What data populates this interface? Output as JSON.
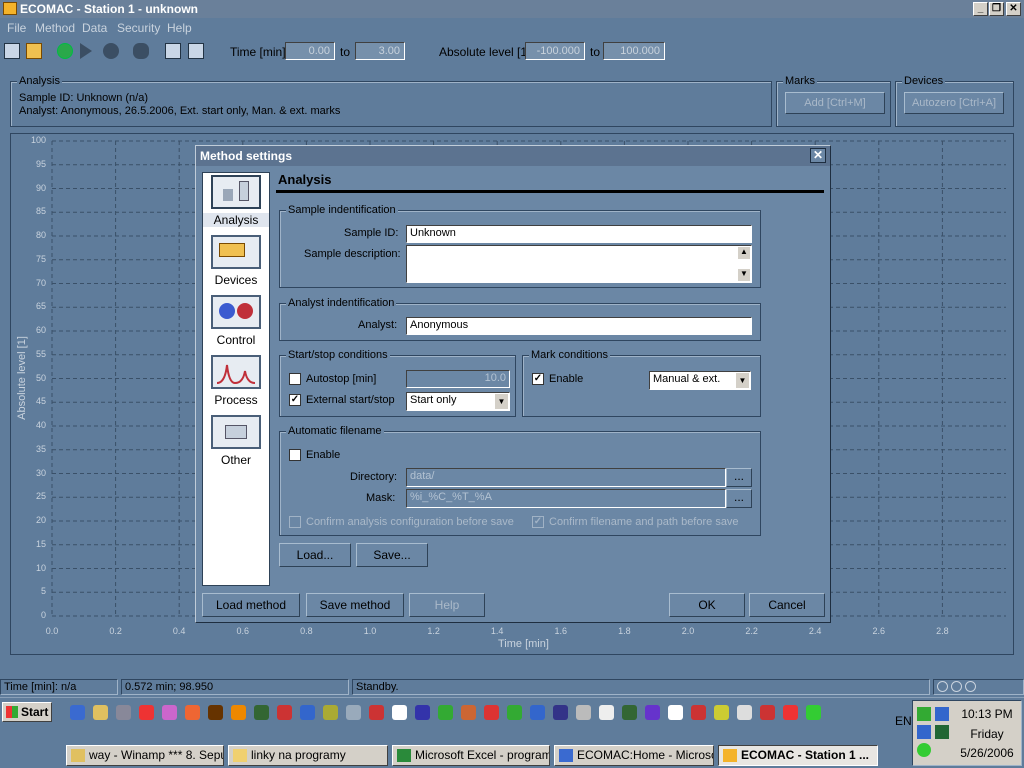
{
  "window": {
    "title": "ECOMAC - Station 1 - unknown",
    "min_icon": "minimize-icon",
    "max_icon": "restore-icon",
    "close_icon": "close-icon"
  },
  "menu": [
    "File",
    "Method",
    "Data",
    "Security",
    "Help"
  ],
  "toolbar": {
    "time_label": "Time [min]:",
    "time_from": "0.00",
    "to1": "to",
    "time_to": "3.00",
    "level_label": "Absolute level [1]",
    "level_from": "-100.000",
    "to2": "to",
    "level_to": "100.000"
  },
  "analysis_panel": {
    "title": "Analysis",
    "line1": "Sample ID: Unknown (n/a)",
    "line2": "Analyst: Anonymous, 26.5.2006, Ext. start only, Man. & ext. marks"
  },
  "marks_panel": {
    "title": "Marks",
    "button": "Add [Ctrl+M]"
  },
  "devices_panel": {
    "title": "Devices",
    "button": "Autozero [Ctrl+A]"
  },
  "chart_data": {
    "type": "line",
    "title": "",
    "xlabel": "Time [min]",
    "ylabel": "Absolute level [1]",
    "xlim": [
      0.0,
      3.0
    ],
    "ylim": [
      0,
      100
    ],
    "x_ticks": [
      "0.0",
      "0.2",
      "0.4",
      "0.6",
      "0.8",
      "1.0",
      "1.2",
      "1.4",
      "1.6",
      "1.8",
      "2.0",
      "2.2",
      "2.4",
      "2.6",
      "2.8"
    ],
    "y_ticks": [
      "100",
      "95",
      "90",
      "85",
      "80",
      "75",
      "70",
      "65",
      "60",
      "55",
      "50",
      "45",
      "40",
      "35",
      "30",
      "25",
      "20",
      "15",
      "10",
      "5",
      "0"
    ],
    "grid": true,
    "series": []
  },
  "dialog": {
    "title": "Method settings",
    "nav": [
      {
        "label": "Analysis",
        "icon": "analysis-flask-icon"
      },
      {
        "label": "Devices",
        "icon": "devices-icon"
      },
      {
        "label": "Control",
        "icon": "control-gears-icon"
      },
      {
        "label": "Process",
        "icon": "process-peaks-icon"
      },
      {
        "label": "Other",
        "icon": "other-icon"
      }
    ],
    "heading": "Analysis",
    "sample": {
      "group": "Sample indentification",
      "id_label": "Sample ID:",
      "id_value": "Unknown",
      "desc_label": "Sample description:",
      "desc_value": ""
    },
    "analyst": {
      "group": "Analyst indentification",
      "label": "Analyst:",
      "value": "Anonymous"
    },
    "startstop": {
      "group": "Start/stop conditions",
      "autostop_label": "Autostop [min]",
      "autostop_value": "10.0",
      "external_label": "External start/stop",
      "external_value": "Start only"
    },
    "marks": {
      "group": "Mark conditions",
      "enable_label": "Enable",
      "select_value": "Manual & ext."
    },
    "autofile": {
      "group": "Automatic filename",
      "enable_label": "Enable",
      "dir_label": "Directory:",
      "dir_value": "data/",
      "mask_label": "Mask:",
      "mask_value": "%i_%C_%T_%A",
      "browse": "...",
      "confirm1": "Confirm analysis configuration before save",
      "confirm2": "Confirm filename and path before save"
    },
    "load_btn": "Load...",
    "save_btn": "Save...",
    "load_method": "Load method",
    "save_method": "Save method",
    "help": "Help",
    "ok": "OK",
    "cancel": "Cancel"
  },
  "statusbar": {
    "time": "Time [min]: n/a",
    "cursor": "0.572 min; 98.950",
    "state": "Standby."
  },
  "taskbar": {
    "start": "Start",
    "lang": "EN",
    "clock": "10:13 PM",
    "day": "Friday",
    "date": "5/26/2006",
    "tasks": [
      "way - Winamp *** 8. Sepu...",
      "linky na programy",
      "Microsoft Excel - program...",
      "ECOMAC:Home - Microso...",
      "ECOMAC - Station 1 ..."
    ]
  }
}
